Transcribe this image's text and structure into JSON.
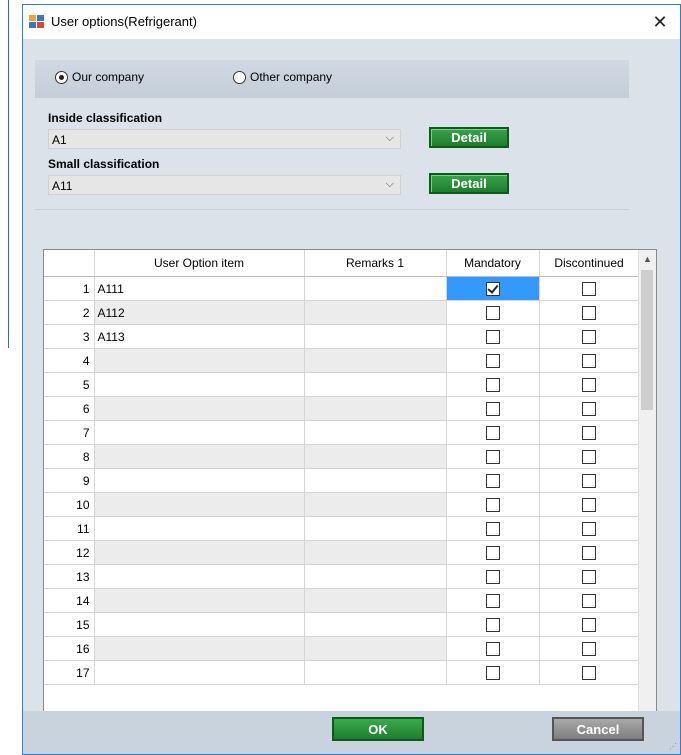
{
  "window": {
    "title": "User options(Refrigerant)",
    "close_glyph": "✕"
  },
  "company": {
    "our_label": "Our company",
    "other_label": "Other company",
    "selected": "our"
  },
  "inside": {
    "label": "Inside classification",
    "value": "A1",
    "detail_label": "Detail"
  },
  "small": {
    "label": "Small classification",
    "value": "A11",
    "detail_label": "Detail"
  },
  "grid": {
    "headers": [
      "User Option item",
      "Remarks 1",
      "Mandatory",
      "Discontinued"
    ],
    "rows": [
      {
        "num": "1",
        "item": "A111",
        "remarks": "",
        "mandatory": true,
        "discontinued": false
      },
      {
        "num": "2",
        "item": "A112",
        "remarks": "",
        "mandatory": false,
        "discontinued": false
      },
      {
        "num": "3",
        "item": "A113",
        "remarks": "",
        "mandatory": false,
        "discontinued": false
      },
      {
        "num": "4",
        "item": "",
        "remarks": "",
        "mandatory": false,
        "discontinued": false
      },
      {
        "num": "5",
        "item": "",
        "remarks": "",
        "mandatory": false,
        "discontinued": false
      },
      {
        "num": "6",
        "item": "",
        "remarks": "",
        "mandatory": false,
        "discontinued": false
      },
      {
        "num": "7",
        "item": "",
        "remarks": "",
        "mandatory": false,
        "discontinued": false
      },
      {
        "num": "8",
        "item": "",
        "remarks": "",
        "mandatory": false,
        "discontinued": false
      },
      {
        "num": "9",
        "item": "",
        "remarks": "",
        "mandatory": false,
        "discontinued": false
      },
      {
        "num": "10",
        "item": "",
        "remarks": "",
        "mandatory": false,
        "discontinued": false
      },
      {
        "num": "11",
        "item": "",
        "remarks": "",
        "mandatory": false,
        "discontinued": false
      },
      {
        "num": "12",
        "item": "",
        "remarks": "",
        "mandatory": false,
        "discontinued": false
      },
      {
        "num": "13",
        "item": "",
        "remarks": "",
        "mandatory": false,
        "discontinued": false
      },
      {
        "num": "14",
        "item": "",
        "remarks": "",
        "mandatory": false,
        "discontinued": false
      },
      {
        "num": "15",
        "item": "",
        "remarks": "",
        "mandatory": false,
        "discontinued": false
      },
      {
        "num": "16",
        "item": "",
        "remarks": "",
        "mandatory": false,
        "discontinued": false
      },
      {
        "num": "17",
        "item": "",
        "remarks": "",
        "mandatory": false,
        "discontinued": false
      }
    ]
  },
  "buttons": {
    "ok": "OK",
    "cancel": "Cancel"
  },
  "colors": {
    "accent_green": "#1f7d2e",
    "selection_blue": "#3399ff",
    "window_border": "#2d7dd2"
  },
  "icons": {
    "app": "app-window-icon",
    "close": "close-icon",
    "dropdown": "chevron-down-icon",
    "scroll_up": "chevron-up-icon",
    "scroll_down": "chevron-down-icon"
  }
}
